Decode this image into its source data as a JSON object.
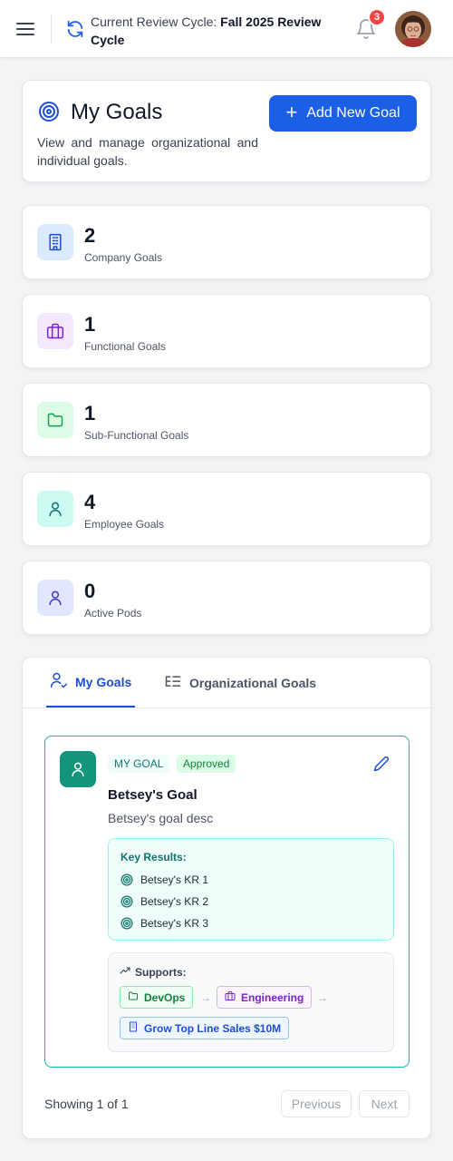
{
  "header": {
    "cycle_prefix": "Current Review Cycle:",
    "cycle_name": "Fall 2025 Review Cycle",
    "notification_count": "3"
  },
  "page": {
    "title": "My Goals",
    "description": "View and manage organizational and individual goals.",
    "add_button": "Add New Goal"
  },
  "stats": [
    {
      "value": "2",
      "label": "Company Goals",
      "icon": "building-icon",
      "bg": "#dbeafe",
      "fg": "#1d4ed8"
    },
    {
      "value": "1",
      "label": "Functional Goals",
      "icon": "briefcase-icon",
      "bg": "#f3e8ff",
      "fg": "#7e22ce"
    },
    {
      "value": "1",
      "label": "Sub-Functional Goals",
      "icon": "folder-icon",
      "bg": "#dcfce7",
      "fg": "#16a34a"
    },
    {
      "value": "4",
      "label": "Employee Goals",
      "icon": "user-icon",
      "bg": "#ccfbf1",
      "fg": "#0f766e"
    },
    {
      "value": "0",
      "label": "Active Pods",
      "icon": "user-icon",
      "bg": "#e0e7ff",
      "fg": "#4338ca"
    }
  ],
  "tabs": [
    {
      "label": "My Goals",
      "icon": "user-check-icon",
      "active": true
    },
    {
      "label": "Organizational Goals",
      "icon": "hierarchy-list-icon",
      "active": false
    }
  ],
  "goal": {
    "type_badge": "MY GOAL",
    "status_badge": "Approved",
    "title": "Betsey's Goal",
    "description": "Betsey's goal desc",
    "key_results_label": "Key Results:",
    "key_results": [
      "Betsey's KR 1",
      "Betsey's KR 2",
      "Betsey's KR 3"
    ],
    "supports_label": "Supports:",
    "supports": [
      "DevOps",
      "Engineering",
      "Grow Top Line Sales $10M"
    ]
  },
  "pagination": {
    "summary": "Showing 1 of 1",
    "previous": "Previous",
    "next": "Next"
  },
  "colors": {
    "primary": "#1a5fe6",
    "goal_accent": "#14937d",
    "badge": "#ef4444"
  }
}
